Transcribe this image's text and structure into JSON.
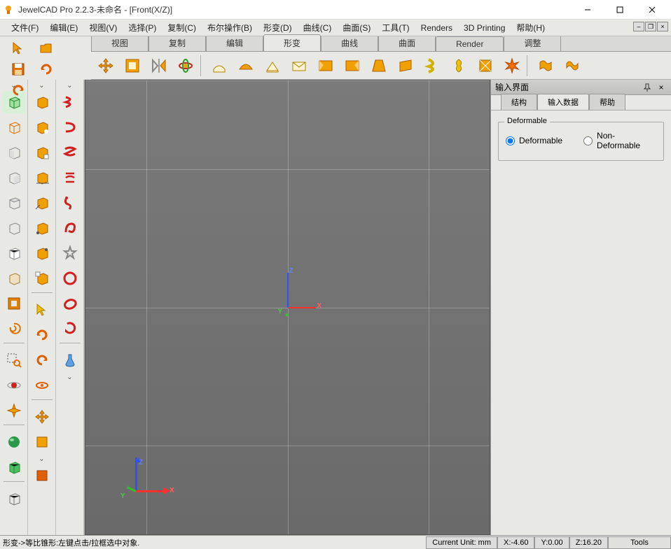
{
  "title": "JewelCAD Pro 2.2.3-未命名 - [Front(X/Z)]",
  "menus": [
    "文件(F)",
    "编辑(E)",
    "视图(V)",
    "选择(P)",
    "复制(C)",
    "布尔操作(B)",
    "形变(D)",
    "曲线(C)",
    "曲面(S)",
    "工具(T)",
    "Renders",
    "3D Printing",
    "帮助(H)"
  ],
  "tabs": [
    "视图",
    "复制",
    "编辑",
    "形变",
    "曲线",
    "曲面",
    "Render",
    "调整"
  ],
  "active_tab": 3,
  "panel": {
    "title": "输入界面",
    "tabs": [
      "结构",
      "输入数据",
      "帮助"
    ],
    "active_tab": 1,
    "group_label": "Deformable",
    "radio1": "Deformable",
    "radio2": "Non-Deformable",
    "selected_radio": 0
  },
  "status": {
    "message": "形变->等比锥形:左键点击/拉框选中对象.",
    "unit_label": "Current Unit:   mm",
    "x": "X:-4.60",
    "y": "Y:0.00",
    "z": "Z:16.20",
    "tools": "Tools"
  },
  "axes": {
    "center": {
      "x": "X",
      "y": "Y",
      "z": "Z"
    },
    "corner": {
      "x": "X",
      "y": "Y",
      "z": "Z"
    }
  },
  "icons": {
    "arrow": "arrow",
    "folder": "folder",
    "save": "save",
    "redo": "redo",
    "undo": "undo",
    "move": "move",
    "rect": "rect",
    "mirror": "mirror",
    "rotate": "rot",
    "extrude": "ext",
    "dome": "dome",
    "box3d": "box",
    "sheet": "sheet",
    "bevel1": "bv1",
    "bevel2": "bv2",
    "prism": "prism",
    "slab": "slab",
    "twist": "twist",
    "ring": "ring",
    "patch": "patch",
    "burst": "burst",
    "wave1": "w1",
    "wave2": "w2",
    "cube_sel": "cube",
    "cube2": "c2",
    "cube3": "c3",
    "cube4": "c4",
    "cube5": "c5",
    "cube6": "c6",
    "cube7": "c7",
    "cube8": "c8",
    "frame": "fr",
    "swirl": "sw",
    "zoom": "zm",
    "target": "tg",
    "compass": "cp",
    "sphere": "sp",
    "cube_green": "cg",
    "iso": "iso",
    "obox1": "ob1",
    "obox2": "ob2",
    "obox3": "ob3",
    "obox4": "ob4",
    "obox5": "ob5",
    "obox6": "ob6",
    "obox7": "ob7",
    "obox8": "ob8",
    "ptr": "ptr",
    "orot1": "or1",
    "orot2": "or2",
    "orot3": "or3",
    "omove": "omv",
    "opatch": "opt",
    "oring": "org",
    "snake1": "s1",
    "snake2": "s2",
    "snake3": "s3",
    "snake4": "s4",
    "snake5": "s5",
    "snake6": "s6",
    "star": "star",
    "circle": "cir",
    "oval": "ov",
    "hook": "hk",
    "lamp": "lmp"
  }
}
